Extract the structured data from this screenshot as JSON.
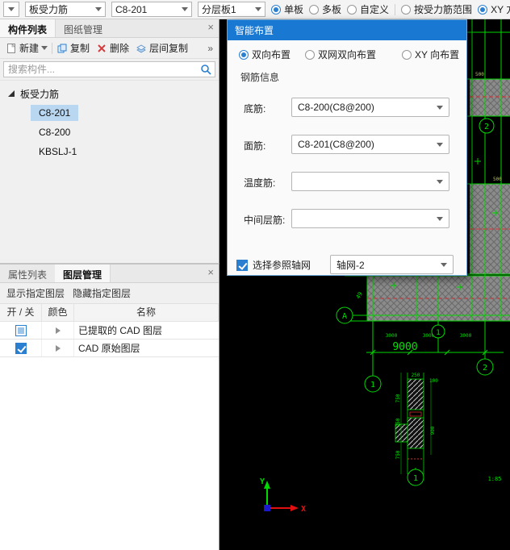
{
  "toolbar": {
    "combos": [
      "板受力筋",
      "C8-201",
      "分层板1"
    ],
    "radios": [
      {
        "label": "单板",
        "checked": true
      },
      {
        "label": "多板",
        "checked": false
      },
      {
        "label": "自定义",
        "checked": false
      },
      {
        "label": "按受力筋范围",
        "checked": false
      },
      {
        "label": "XY 方",
        "checked": true
      }
    ]
  },
  "component_panel": {
    "tabs": [
      {
        "label": "构件列表",
        "active": true
      },
      {
        "label": "图纸管理",
        "active": false
      }
    ],
    "close": "×",
    "actions": [
      {
        "label": "新建"
      },
      {
        "label": "复制"
      },
      {
        "label": "删除"
      },
      {
        "label": "层间复制"
      }
    ],
    "overflow": "»",
    "search": {
      "placeholder": "搜索构件..."
    },
    "tree": {
      "root": "板受力筋",
      "items": [
        {
          "label": "C8-201",
          "selected": true
        },
        {
          "label": "C8-200",
          "selected": false
        },
        {
          "label": "KBSLJ-1",
          "selected": false
        }
      ]
    }
  },
  "layer_panel": {
    "tabs": [
      {
        "label": "属性列表",
        "active": false
      },
      {
        "label": "图层管理",
        "active": true
      }
    ],
    "close": "×",
    "buttons": [
      "显示指定图层",
      "隐藏指定图层"
    ],
    "table": {
      "headers": [
        "开 / 关",
        "颜色",
        "名称"
      ],
      "rows": [
        {
          "checked": "partial",
          "name": "已提取的 CAD 图层"
        },
        {
          "checked": true,
          "name": "CAD 原始图层"
        }
      ]
    }
  },
  "dialog": {
    "title": "智能布置",
    "layout_radios": [
      {
        "label": "双向布置",
        "checked": true
      },
      {
        "label": "双网双向布置",
        "checked": false
      },
      {
        "label": "XY 向布置",
        "checked": false
      }
    ],
    "group_title": "钢筋信息",
    "fields": [
      {
        "label": "底筋:",
        "value": "C8-200(C8@200)"
      },
      {
        "label": "面筋:",
        "value": "C8-201(C8@200)"
      },
      {
        "label": "温度筋:",
        "value": ""
      },
      {
        "label": "中间层筋:",
        "value": ""
      }
    ],
    "axis_row": {
      "label": "选择参照轴网",
      "checked": true,
      "value": "轴网-2"
    }
  },
  "cad": {
    "bubbles": {
      "grid2_top": "2",
      "gridA": "A",
      "grid1_small": "1",
      "grid1": "1",
      "grid2": "2",
      "section": "1"
    },
    "dim_main": "9000",
    "small_dims": [
      "3000",
      "3000",
      "3000"
    ],
    "tiny_dims": [
      "500",
      "500"
    ],
    "rot_dim": "49",
    "section_dims": [
      "250",
      "750",
      "250",
      "750",
      "900",
      "100"
    ],
    "note": "1:85",
    "axes": {
      "x": "X",
      "y": "Y"
    }
  }
}
